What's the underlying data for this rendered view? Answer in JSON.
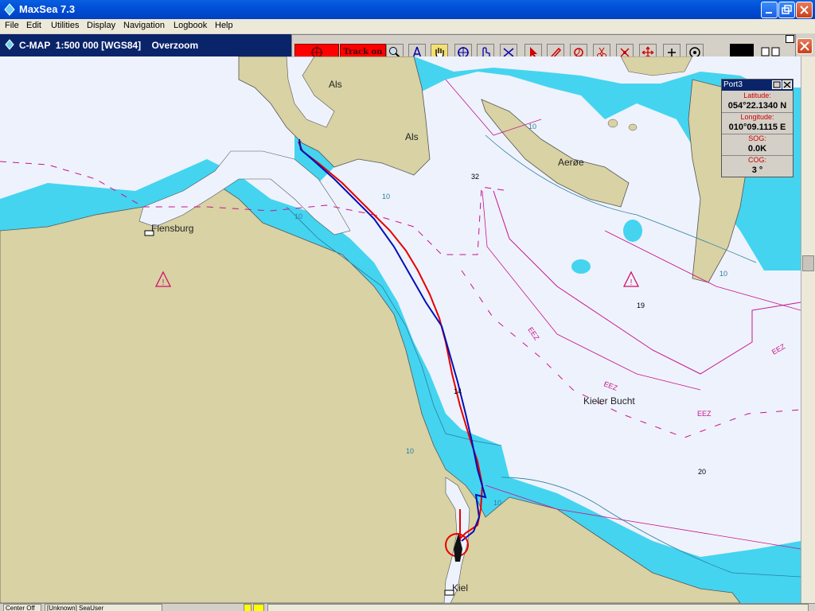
{
  "window": {
    "title": "MaxSea 7.3"
  },
  "menu": [
    "File",
    "Edit",
    "Utilities",
    "Display",
    "Navigation",
    "Logbook",
    "Help"
  ],
  "chart_header": {
    "title": "C-MAP  1:500 000 [WGS84]    Overzoom"
  },
  "toolbar": {
    "track_label": "Track on"
  },
  "port_panel": {
    "title": "Port3",
    "lat_label": "Latitude:",
    "lat_value": "054°22.1340 N",
    "lon_label": "Longitude:",
    "lon_value": "010°09.1115 E",
    "sog_label": "SOG:",
    "sog_value": "0.0K",
    "cog_label": "COG:",
    "cog_value": "3 °"
  },
  "map_labels": {
    "als1": "Als",
    "als2": "Als",
    "aeroe": "Aerøe",
    "flensburg": "Flensburg",
    "kieler_bucht": "Kieler Bucht",
    "kiel": "Kiel",
    "eez": "EEZ",
    "depth_32": "32",
    "depth_19": "19",
    "depth_20": "20",
    "depth_14": "14",
    "contour_10": "10"
  },
  "status": {
    "cell1": "Center Off",
    "cell2": "[Unknown] SeaUser"
  },
  "colors": {
    "sea_shallow": "#44d4f0",
    "sea_deep": "#eef2fc",
    "land": "#d8d2a4",
    "track_red": "#e60000",
    "track_blue": "#0010b8",
    "eez": "#c8148c"
  }
}
